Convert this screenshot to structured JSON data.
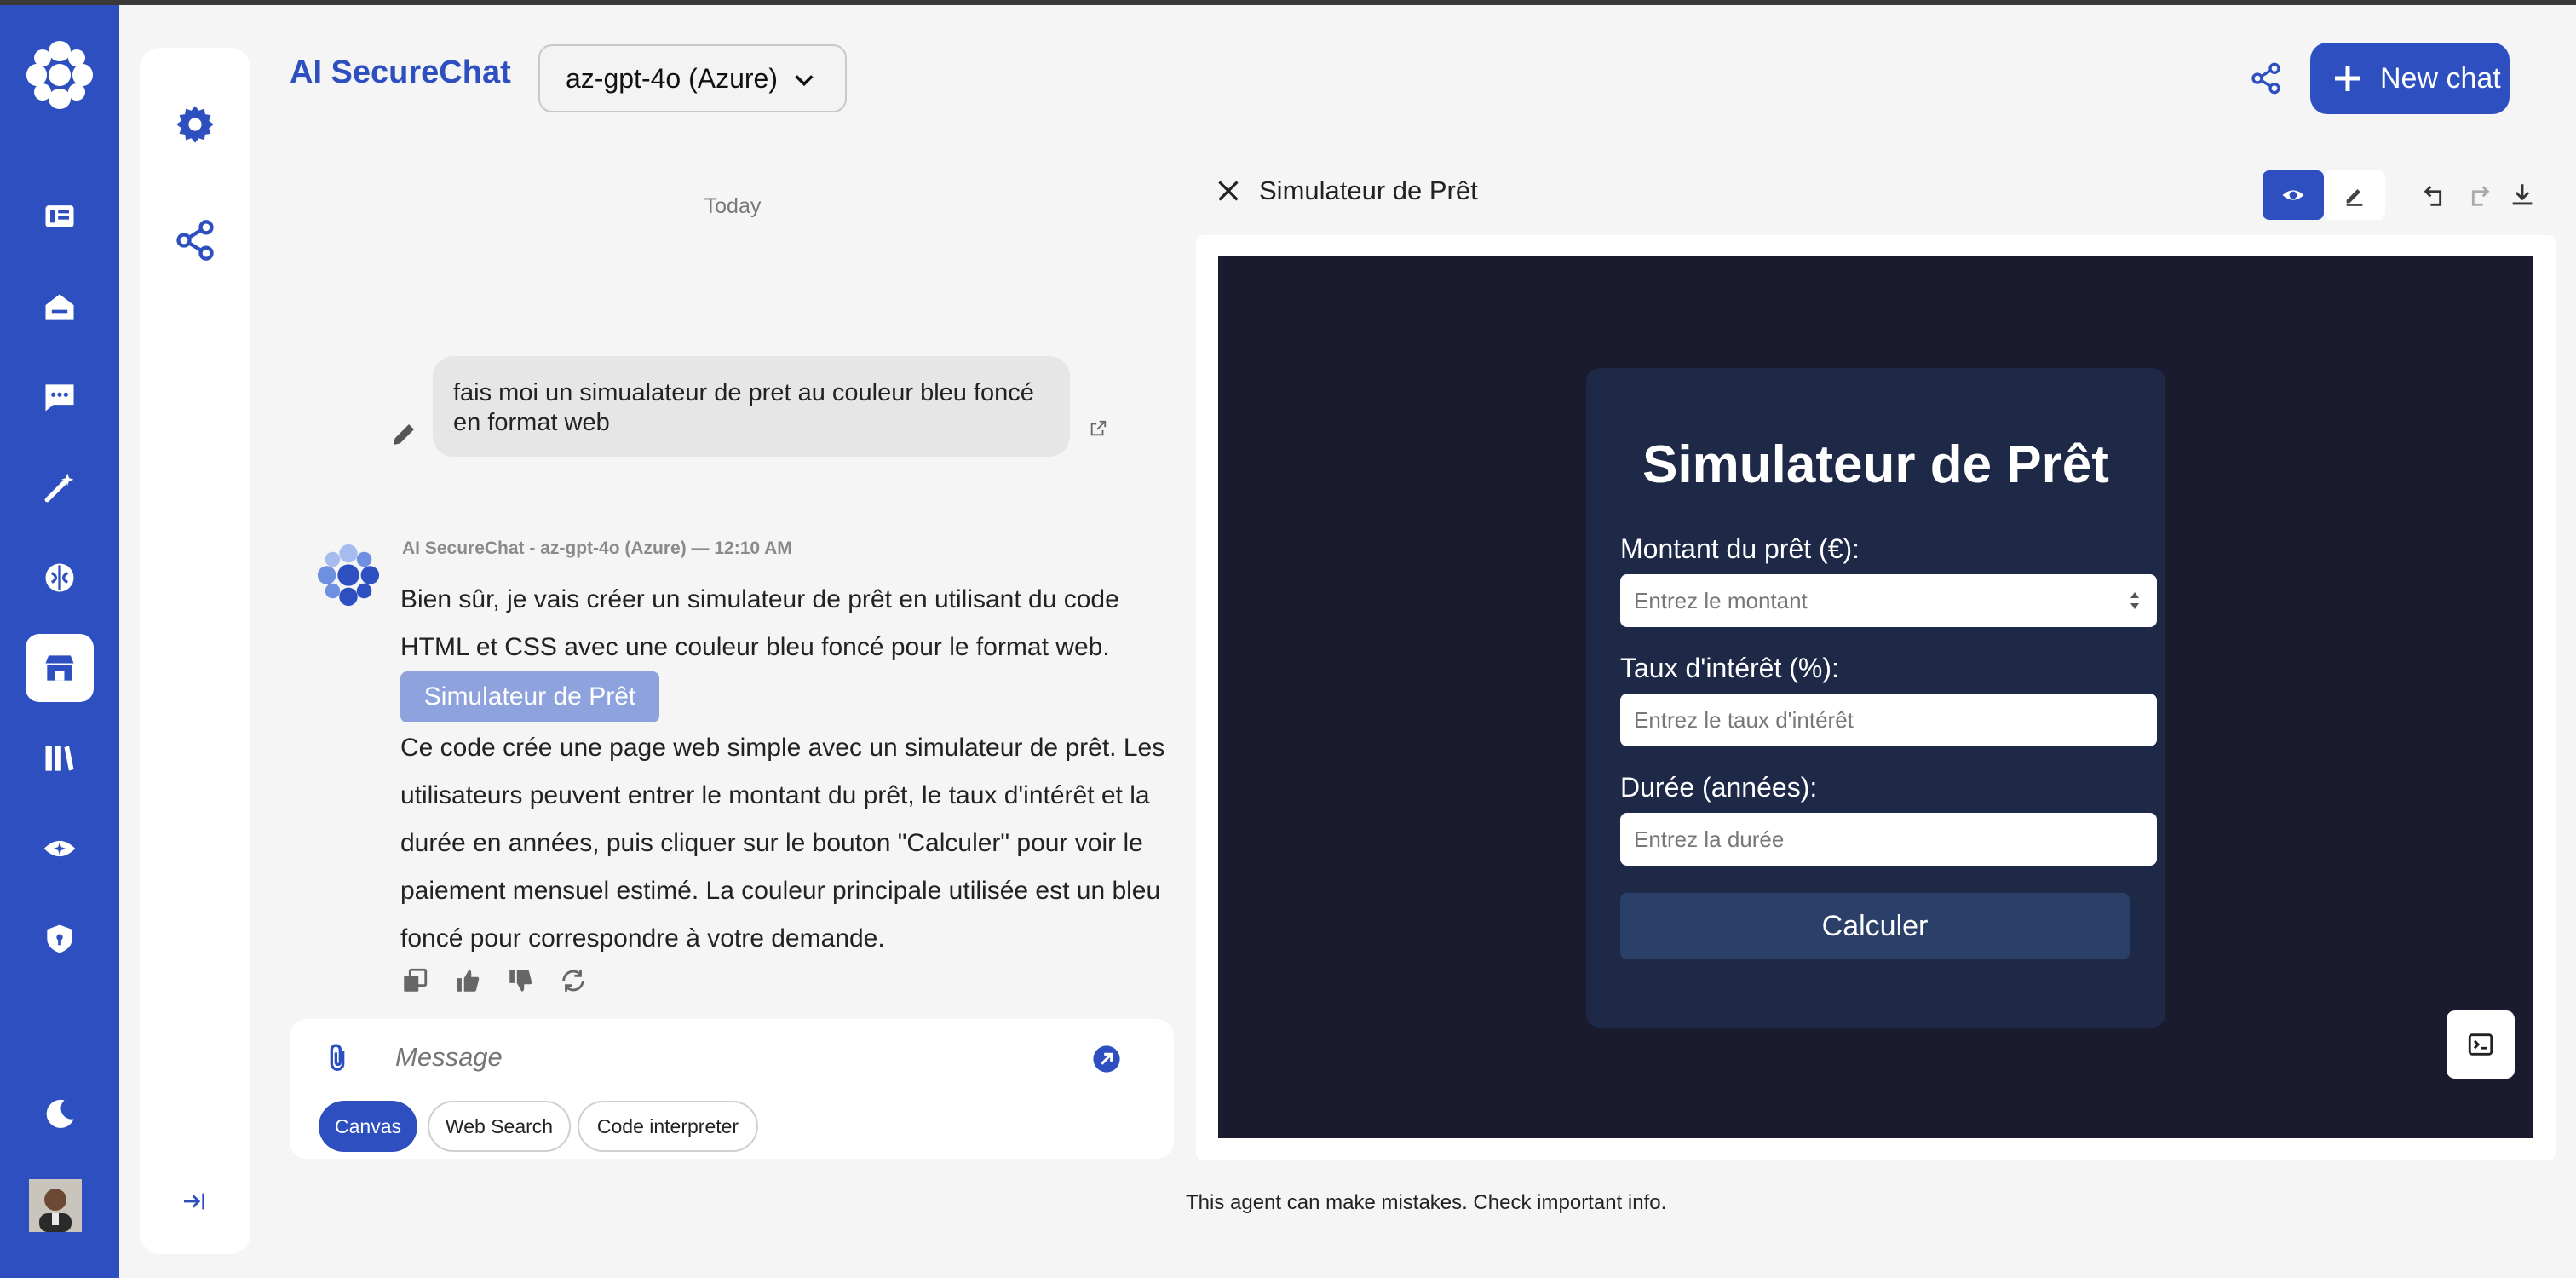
{
  "app": {
    "title": "AI SecureChat",
    "model": "az-gpt-4o (Azure)",
    "new_chat_label": "New chat",
    "brand_color": "#2d4fbf"
  },
  "rail": {
    "items": [
      {
        "icon": "news-icon"
      },
      {
        "icon": "home-icon"
      },
      {
        "icon": "chat-icon"
      },
      {
        "icon": "magic-wand-icon"
      },
      {
        "icon": "brain-icon"
      },
      {
        "icon": "store-icon",
        "active": true
      },
      {
        "icon": "library-icon"
      },
      {
        "icon": "eye-icon"
      },
      {
        "icon": "shield-icon"
      }
    ],
    "bottom": [
      {
        "icon": "moon-icon"
      },
      {
        "icon": "avatar"
      }
    ]
  },
  "chat": {
    "date_separator": "Today",
    "user_message": "fais moi un simualateur de pret au couleur bleu foncé en format web",
    "ai_meta": "AI SecureChat - az-gpt-4o (Azure) — 12:10 AM",
    "ai_text_1": "Bien sûr, je vais créer un simulateur de prêt en utilisant du code HTML et CSS avec une couleur bleu foncé pour le format web.",
    "canvas_chip": "Simulateur de Prêt",
    "ai_text_2": "Ce code crée une page web simple avec un simulateur de prêt. Les utilisateurs peuvent entrer le montant du prêt, le taux d'intérêt et la durée en années, puis cliquer sur le bouton \"Calculer\" pour voir le paiement mensuel estimé. La couleur principale utilisée est un bleu foncé pour correspondre à votre demande."
  },
  "composer": {
    "placeholder": "Message",
    "chips": {
      "canvas": "Canvas",
      "web_search": "Web Search",
      "code_interpreter": "Code interpreter"
    }
  },
  "disclaimer": "This agent can make mistakes. Check important info.",
  "canvas": {
    "title": "Simulateur de Prêt",
    "preview": {
      "heading": "Simulateur de Prêt",
      "amount_label": "Montant du prêt (€):",
      "amount_placeholder": "Entrez le montant",
      "rate_label": "Taux d'intérêt (%):",
      "rate_placeholder": "Entrez le taux d'intérêt",
      "duration_label": "Durée (années):",
      "duration_placeholder": "Entrez la durée",
      "button": "Calculer"
    }
  }
}
